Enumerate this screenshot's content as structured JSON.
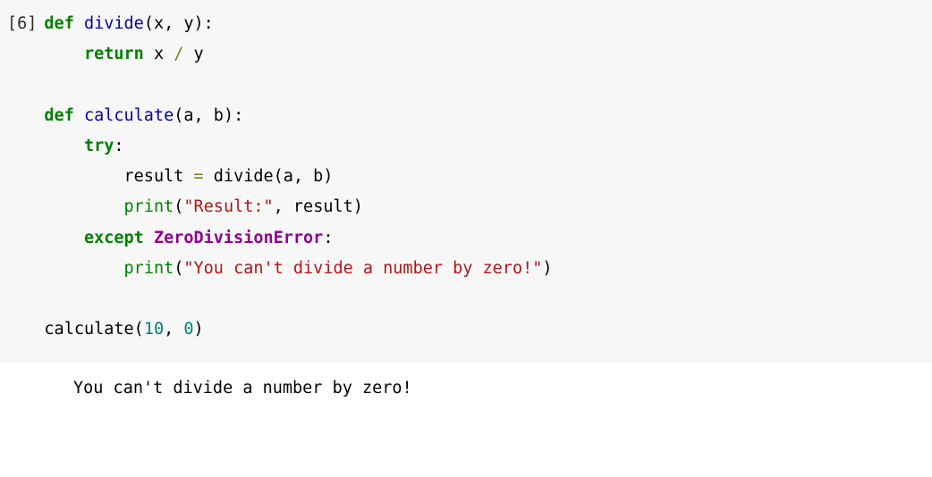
{
  "cell": {
    "execution_count": "[6]",
    "code": {
      "tokens": [
        [
          [
            "def ",
            "kw"
          ],
          [
            "divide",
            "fn"
          ],
          [
            "(",
            ""
          ],
          [
            "x",
            "param"
          ],
          [
            ", ",
            ""
          ],
          [
            "y",
            "param"
          ],
          [
            "):",
            ""
          ]
        ],
        [
          [
            "    ",
            ""
          ],
          [
            "return ",
            "kw"
          ],
          [
            "x ",
            ""
          ],
          [
            "/",
            "op"
          ],
          [
            " y",
            ""
          ]
        ],
        [
          [
            "",
            ""
          ]
        ],
        [
          [
            "def ",
            "kw"
          ],
          [
            "calculate",
            "fn"
          ],
          [
            "(",
            ""
          ],
          [
            "a",
            "param"
          ],
          [
            ", ",
            ""
          ],
          [
            "b",
            "param"
          ],
          [
            "):",
            ""
          ]
        ],
        [
          [
            "    ",
            ""
          ],
          [
            "try",
            "kw"
          ],
          [
            ":",
            ""
          ]
        ],
        [
          [
            "    ",
            "guide"
          ],
          [
            "    result ",
            ""
          ],
          [
            "=",
            "op"
          ],
          [
            " divide(a, b)",
            ""
          ]
        ],
        [
          [
            "    ",
            "guide"
          ],
          [
            "    ",
            ""
          ],
          [
            "print",
            "bi"
          ],
          [
            "(",
            ""
          ],
          [
            "\"Result:\"",
            "str"
          ],
          [
            ", result)",
            ""
          ]
        ],
        [
          [
            "    ",
            ""
          ],
          [
            "except ",
            "kw"
          ],
          [
            "ZeroDivisionError",
            "err"
          ],
          [
            ":",
            ""
          ]
        ],
        [
          [
            "    ",
            "guide"
          ],
          [
            "    ",
            ""
          ],
          [
            "print",
            "bi"
          ],
          [
            "(",
            ""
          ],
          [
            "\"You can't divide a number by zero!\"",
            "str"
          ],
          [
            ")",
            ""
          ]
        ],
        [
          [
            "",
            ""
          ]
        ],
        [
          [
            "calculate(",
            ""
          ],
          [
            "10",
            "num"
          ],
          [
            ", ",
            ""
          ],
          [
            "0",
            "num"
          ],
          [
            ")",
            ""
          ]
        ]
      ]
    },
    "output": "You can't divide a number by zero!"
  }
}
